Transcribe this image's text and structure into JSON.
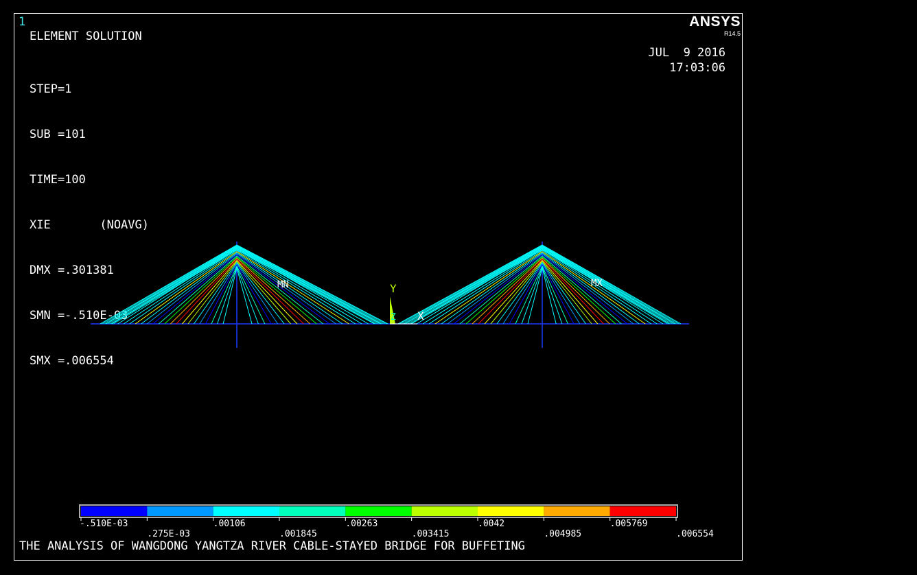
{
  "window_number": "1",
  "title": "ELEMENT SOLUTION",
  "params": [
    "STEP=1",
    "SUB =101",
    "TIME=100",
    "XIE       (NOAVG)",
    "DMX =.301381",
    "SMN =-.510E-03",
    "SMX =.006554"
  ],
  "logo": "ANSYS",
  "version": "R14.5",
  "date": "JUL  9 2016",
  "time": "17:03:06",
  "markers": {
    "min": "MN",
    "max": "MX"
  },
  "axes": {
    "y": "Y",
    "z": "Z",
    "x": "X"
  },
  "legend": {
    "colors": [
      "#0000ff",
      "#0099ff",
      "#00ffff",
      "#00ffbb",
      "#00ff00",
      "#bbff00",
      "#ffff00",
      "#ffaa00",
      "#ff0000"
    ],
    "labels": [
      ".510E-03",
      ".275E-03",
      ".00106",
      ".001845",
      ".00263",
      ".003415",
      ".0042",
      ".004985",
      ".005769",
      ".006554"
    ],
    "first_sign": "-"
  },
  "caption": "THE ANALYSIS OF WANGDONG YANGTZA RIVER CABLE-STAYED BRIDGE FOR BUFFETING"
}
